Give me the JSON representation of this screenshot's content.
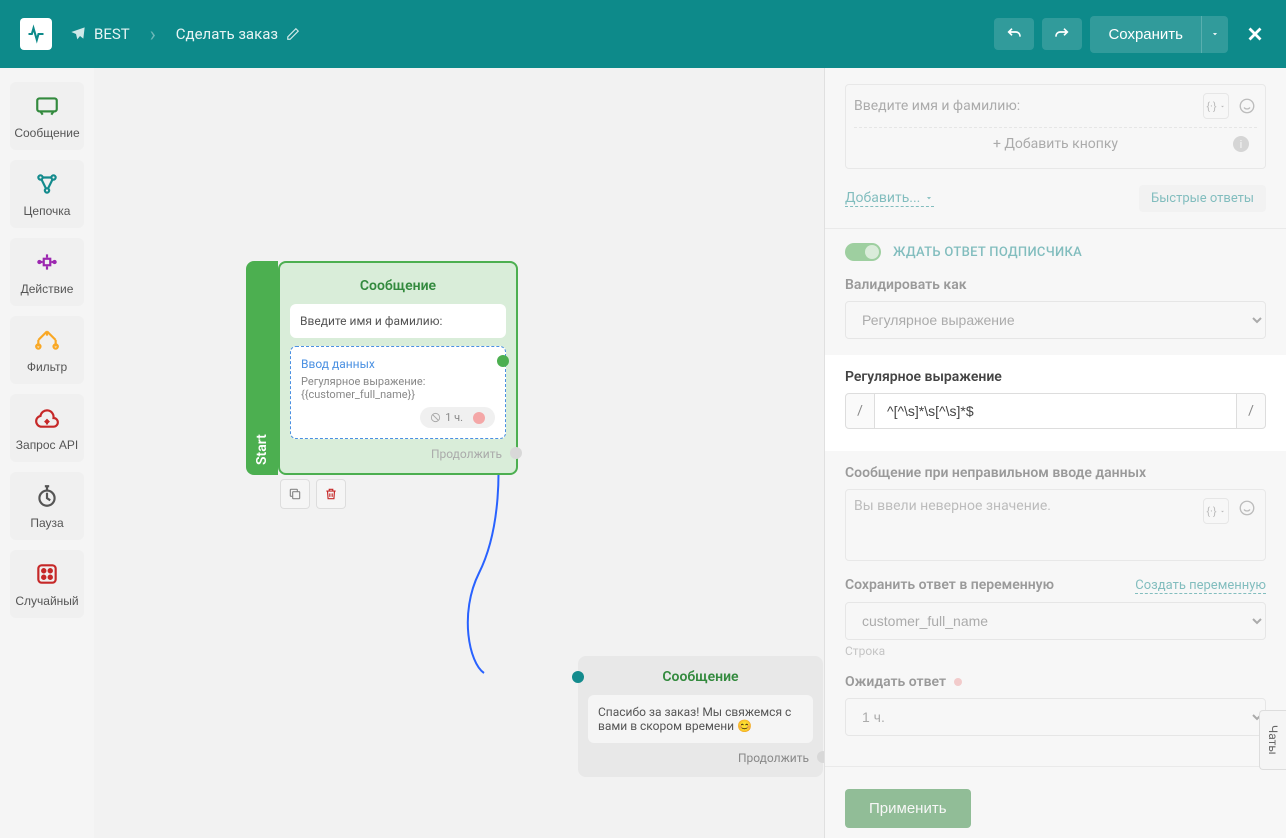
{
  "header": {
    "bot_name": "BEST",
    "page_name": "Сделать заказ",
    "undo_label": "Undo",
    "redo_label": "Redo",
    "save_label": "Сохранить"
  },
  "toolbar": {
    "message": "Сообщение",
    "chain": "Цепочка",
    "action": "Действие",
    "filter": "Фильтр",
    "api": "Запрос API",
    "pause": "Пауза",
    "random": "Случайный"
  },
  "canvas": {
    "start_tag": "Start",
    "node1": {
      "title": "Сообщение",
      "message": "Введите имя и фамилию:",
      "data_input_title": "Ввод данных",
      "data_input_sub": "Регулярное выражение:",
      "data_input_var": "{{customer_full_name}}",
      "timer": "1 ч.",
      "continue": "Продолжить"
    },
    "node2": {
      "title": "Сообщение",
      "message": "Спасибо за заказ! Мы свяжемся с вами в скором времени 😊",
      "continue": "Продолжить"
    }
  },
  "panel": {
    "name_prompt": "Введите имя и фамилию:",
    "add_button": "+ Добавить кнопку",
    "add_dropdown": "Добавить...",
    "quick_replies": "Быстрые ответы",
    "wait_reply": "ЖДАТЬ ОТВЕТ ПОДПИСЧИКА",
    "validate_as": "Валидировать как",
    "validate_value": "Регулярное выражение",
    "regex_label": "Регулярное выражение",
    "regex_value": "^[^\\s]*\\s[^\\s]*$",
    "error_msg_label": "Сообщение при неправильном вводе данных",
    "error_msg_value": "Вы ввели неверное значение.",
    "save_var_label": "Сохранить ответ в переменную",
    "create_var": "Создать переменную",
    "save_var_value": "customer_full_name",
    "save_var_type": "Строка",
    "wait_answer_label": "Ожидать ответ",
    "wait_answer_value": "1 ч.",
    "apply": "Применить",
    "var_insert": "{·}"
  },
  "chats_tab": "Чаты"
}
